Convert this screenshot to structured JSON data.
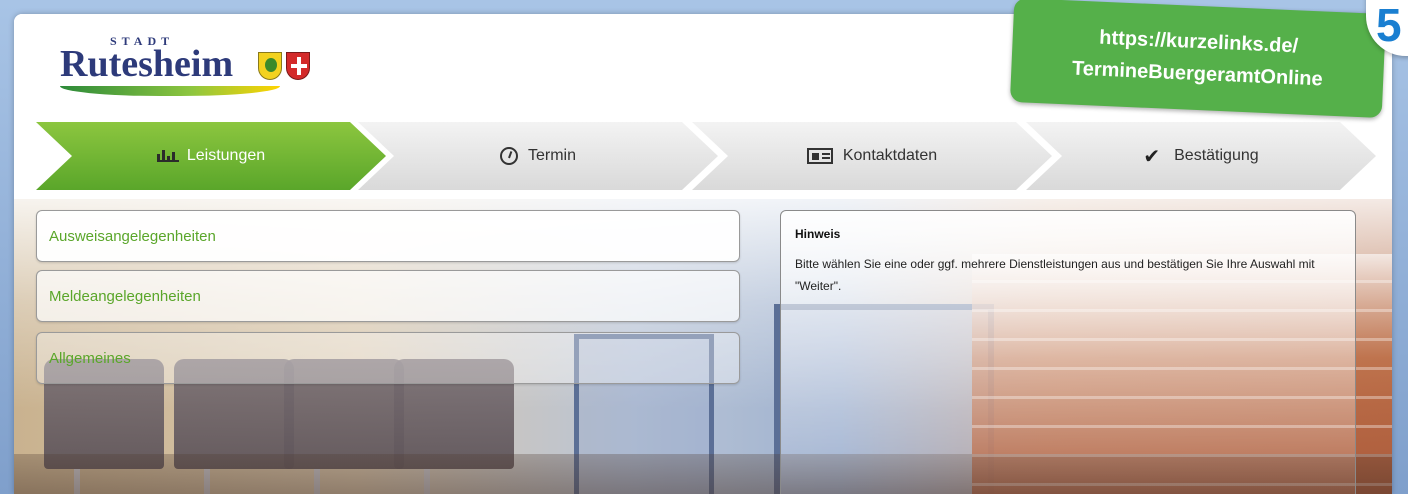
{
  "header": {
    "logo_top": "STADT",
    "logo_name": "Rutesheim"
  },
  "badge": {
    "line1": "https://kurzelinks.de/",
    "line2": "TermineBuergeramtOnline",
    "corner_digit": "5"
  },
  "steps": [
    {
      "label": "Leistungen",
      "icon": "building-icon",
      "active": true
    },
    {
      "label": "Termin",
      "icon": "clock-icon",
      "active": false
    },
    {
      "label": "Kontaktdaten",
      "icon": "id-card-icon",
      "active": false
    },
    {
      "label": "Bestätigung",
      "icon": "checkmark-icon",
      "active": false
    }
  ],
  "categories": [
    {
      "label": "Ausweisangelegenheiten"
    },
    {
      "label": "Meldeangelegenheiten"
    },
    {
      "label": "Allgemeines"
    }
  ],
  "info": {
    "title": "Hinweis",
    "text": "Bitte wählen Sie eine oder ggf. mehrere Dienstleistungen aus und bestätigen Sie Ihre Auswahl mit \"Weiter\"."
  },
  "colors": {
    "accent_green": "#5aa62a",
    "badge_green": "#55b04a",
    "logo_blue": "#2d3a7a"
  }
}
